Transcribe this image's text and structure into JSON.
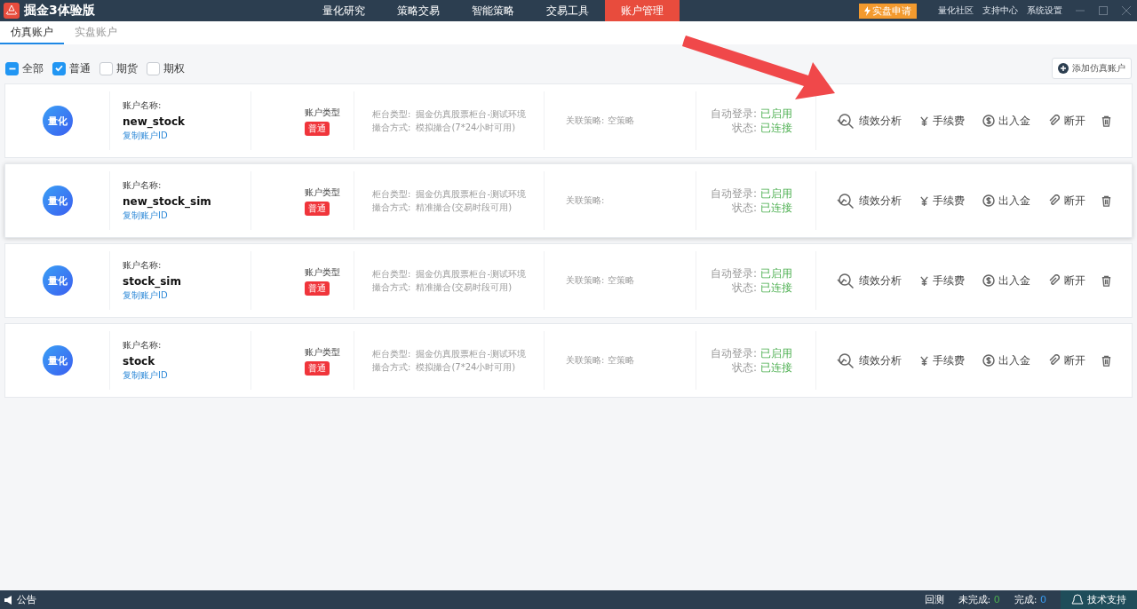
{
  "app": {
    "title": "掘金3体验版"
  },
  "nav": [
    {
      "label": "量化研究",
      "selected": false
    },
    {
      "label": "策略交易",
      "selected": false
    },
    {
      "label": "智能策略",
      "selected": false
    },
    {
      "label": "交易工具",
      "selected": false
    },
    {
      "label": "账户管理",
      "selected": true
    }
  ],
  "apply_button": "实盘申请",
  "top_links": [
    "量化社区",
    "支持中心",
    "系统设置"
  ],
  "tabs": [
    {
      "label": "仿真账户",
      "selected": true
    },
    {
      "label": "实盘账户",
      "selected": false
    }
  ],
  "filters": [
    {
      "label": "全部",
      "checked": true,
      "indeterminate": true
    },
    {
      "label": "普通",
      "checked": true,
      "indeterminate": false
    },
    {
      "label": "期货",
      "checked": false,
      "indeterminate": false
    },
    {
      "label": "期权",
      "checked": false,
      "indeterminate": false
    }
  ],
  "add_button": "添加仿真账户",
  "accounts": [
    {
      "logo": "量化",
      "name_label": "账户名称:",
      "name": "new_stock",
      "copy_link": "复制账户ID",
      "type_label": "账户类型",
      "type": "普通",
      "counter_label": "柜台类型:",
      "counter": "掘金仿真股票柜台-测试环境",
      "match_label": "撮合方式:",
      "match": "模拟撮合(7*24小时可用)",
      "strategy_label": "关联策略:",
      "strategy": "空策略",
      "login_label": "自动登录:",
      "login": "已启用",
      "status_label": "状态:",
      "status": "已连接",
      "highlighted": false,
      "actions": [
        "绩效分析",
        "手续费",
        "出入金",
        "断开"
      ]
    },
    {
      "logo": "量化",
      "name_label": "账户名称:",
      "name": "new_stock_sim",
      "copy_link": "复制账户ID",
      "type_label": "账户类型",
      "type": "普通",
      "counter_label": "柜台类型:",
      "counter": "掘金仿真股票柜台-测试环境",
      "match_label": "撮合方式:",
      "match": "精准撮合(交易时段可用)",
      "strategy_label": "关联策略:",
      "login_label": "自动登录:",
      "login": "已启用",
      "status_label": "状态:",
      "status": "已连接",
      "highlighted": true,
      "actions": [
        "绩效分析",
        "手续费",
        "出入金",
        "断开"
      ]
    },
    {
      "logo": "量化",
      "name_label": "账户名称:",
      "name": "stock_sim",
      "copy_link": "复制账户ID",
      "type_label": "账户类型",
      "type": "普通",
      "counter_label": "柜台类型:",
      "counter": "掘金仿真股票柜台-测试环境",
      "match_label": "撮合方式:",
      "match": "精准撮合(交易时段可用)",
      "strategy_label": "关联策略:",
      "strategy": "空策略",
      "login_label": "自动登录:",
      "login": "已启用",
      "status_label": "状态:",
      "status": "已连接",
      "highlighted": false,
      "actions": [
        "绩效分析",
        "手续费",
        "出入金",
        "断开"
      ]
    },
    {
      "logo": "量化",
      "name_label": "账户名称:",
      "name": "stock",
      "copy_link": "复制账户ID",
      "type_label": "账户类型",
      "type": "普通",
      "counter_label": "柜台类型:",
      "counter": "掘金仿真股票柜台-测试环境",
      "match_label": "撮合方式:",
      "match": "模拟撮合(7*24小时可用)",
      "strategy_label": "关联策略:",
      "strategy": "空策略",
      "login_label": "自动登录:",
      "login": "已启用",
      "status_label": "状态:",
      "status": "已连接",
      "highlighted": false,
      "actions": [
        "绩效分析",
        "手续费",
        "出入金",
        "断开"
      ]
    }
  ],
  "status_bar": {
    "notice": "公告",
    "backtest": "回测",
    "pending_label": "未完成:",
    "pending": "0",
    "done_label": "完成:",
    "done": "0",
    "support": "技术支持"
  }
}
